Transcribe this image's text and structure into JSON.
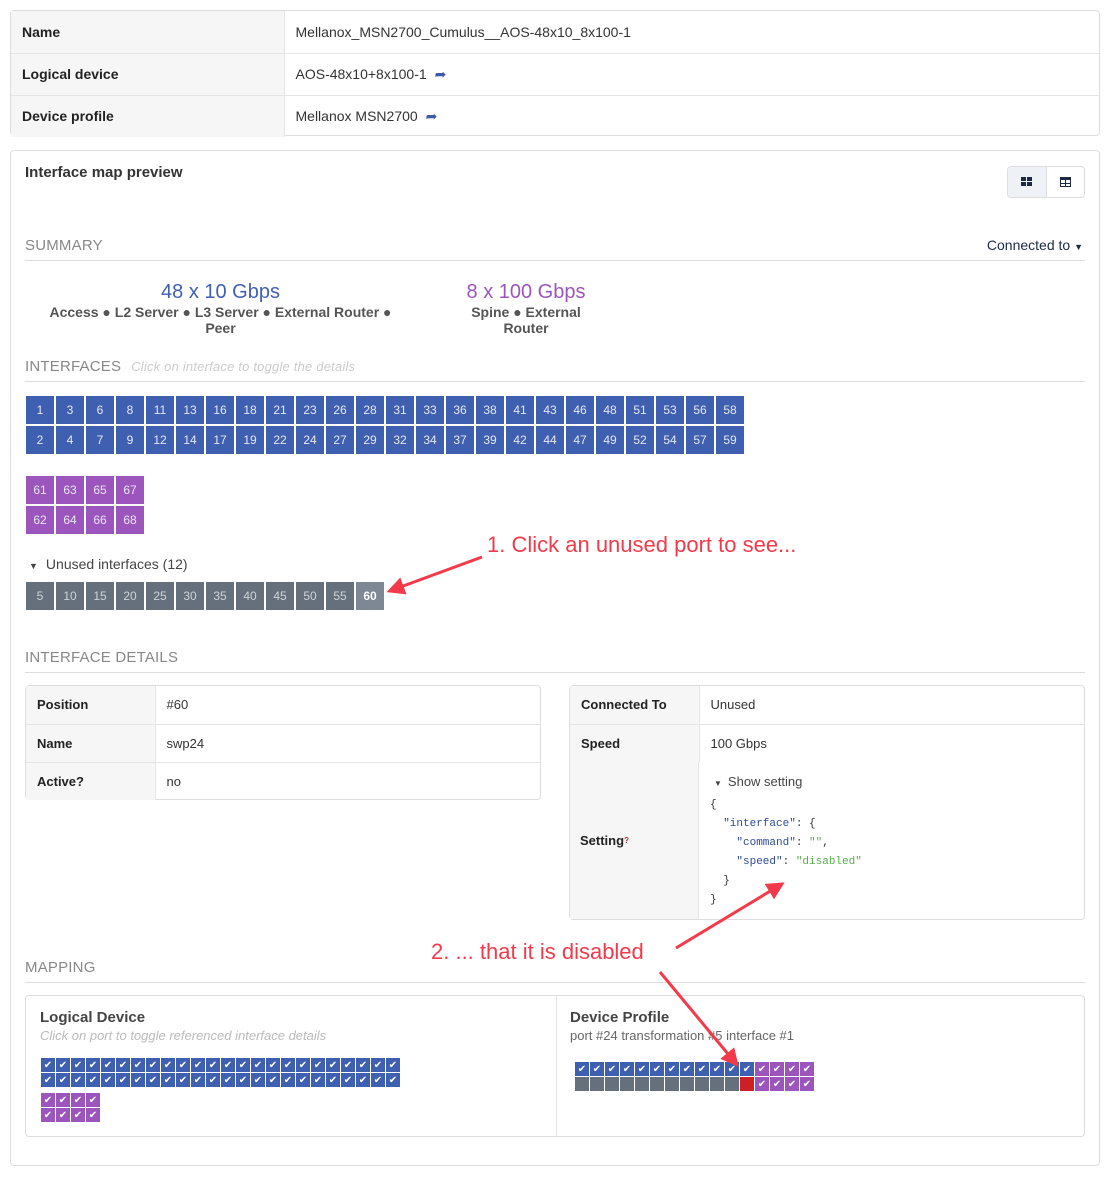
{
  "info": {
    "rows": [
      {
        "label": "Name",
        "value": "Mellanox_MSN2700_Cumulus__AOS-48x10_8x100-1",
        "link": false
      },
      {
        "label": "Logical device",
        "value": "AOS-48x10+8x100-1",
        "link": true
      },
      {
        "label": "Device profile",
        "value": "Mellanox MSN2700",
        "link": true
      }
    ]
  },
  "preview": {
    "title": "Interface map preview",
    "view_toggle": [
      "grid-view",
      "table-view"
    ],
    "active_view": "grid-view"
  },
  "summary": {
    "heading": "SUMMARY",
    "connected_to": "Connected to",
    "groups": [
      {
        "speed": "48 x 10 Gbps",
        "roles": "Access ● L2 Server ● L3 Server ● External Router ● Peer",
        "color": "#3f5fb0"
      },
      {
        "speed": "8 x 100 Gbps",
        "roles": "Spine ● External Router",
        "color": "#9b55bd"
      }
    ]
  },
  "interfaces": {
    "heading": "INTERFACES",
    "hint": "Click on interface to toggle the details",
    "blue_top": [
      1,
      3,
      6,
      8,
      11,
      13,
      16,
      18,
      21,
      23,
      26,
      28,
      31,
      33,
      36,
      38,
      41,
      43,
      46,
      48,
      51,
      53,
      56,
      58
    ],
    "blue_bottom": [
      2,
      4,
      7,
      9,
      12,
      14,
      17,
      19,
      22,
      24,
      27,
      29,
      32,
      34,
      37,
      39,
      42,
      44,
      47,
      49,
      52,
      54,
      57,
      59
    ],
    "purple_top": [
      61,
      63,
      65,
      67
    ],
    "purple_bottom": [
      62,
      64,
      66,
      68
    ],
    "unused_label": "Unused interfaces (12)",
    "unused": [
      5,
      10,
      15,
      20,
      25,
      30,
      35,
      40,
      45,
      50,
      55,
      60
    ],
    "selected": 60
  },
  "details": {
    "heading": "INTERFACE DETAILS",
    "left": [
      {
        "k": "Position",
        "v": "#60"
      },
      {
        "k": "Name",
        "v": "swp24"
      },
      {
        "k": "Active?",
        "v": "no"
      }
    ],
    "right": [
      {
        "k": "Connected To",
        "v": "Unused"
      },
      {
        "k": "Speed",
        "v": "100 Gbps"
      }
    ],
    "setting_label": "Setting",
    "setting_help": "?",
    "show_setting": "Show setting",
    "code": {
      "open": "{",
      "iface_key": "\"interface\"",
      "cmd_key": "\"command\"",
      "cmd_val": "\"\"",
      "speed_key": "\"speed\"",
      "speed_val": "\"disabled\"",
      "close_inner": "}",
      "close": "}"
    }
  },
  "mapping": {
    "heading": "MAPPING",
    "logical": {
      "title": "Logical Device",
      "hint": "Click on port to toggle referenced interface details"
    },
    "profile": {
      "title": "Device Profile",
      "subtitle": "port #24 transformation #5 interface #1"
    }
  },
  "annotations": {
    "a1": "1. Click an unused port to see...",
    "a2": "2. ... that it is disabled",
    "color": "#f23a4a"
  }
}
